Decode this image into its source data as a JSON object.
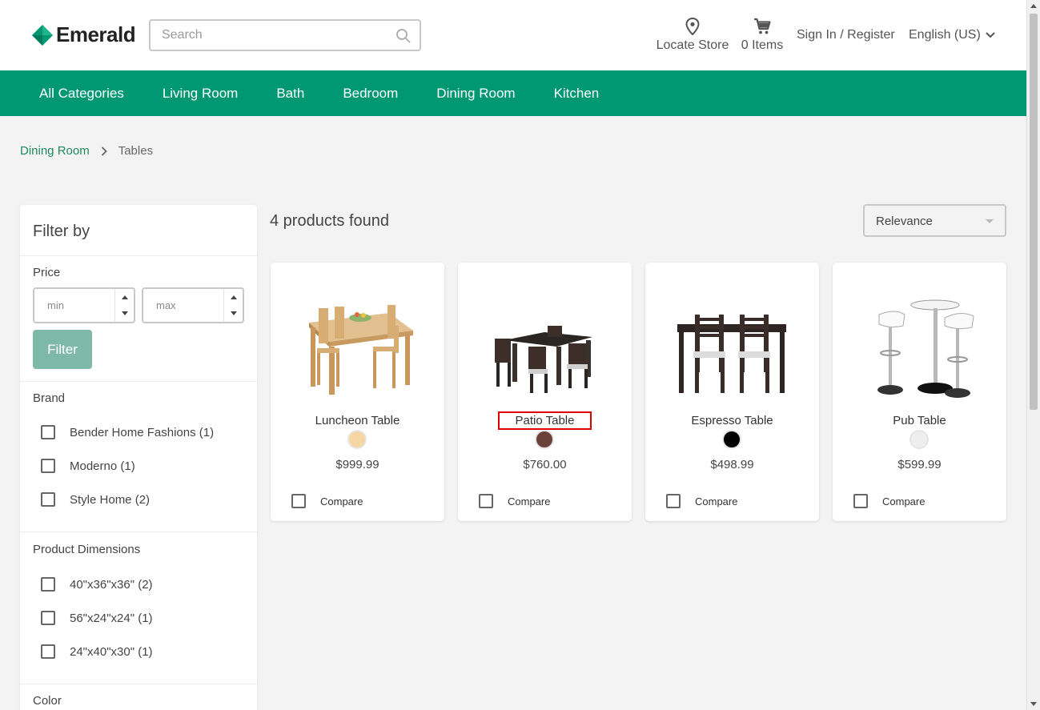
{
  "header": {
    "brand": "Emerald",
    "search_placeholder": "Search",
    "locate_label": "Locate Store",
    "cart_label": "0 Items",
    "signin_label": "Sign In / Register",
    "language_label": "English (US)"
  },
  "nav": {
    "items": [
      "All Categories",
      "Living Room",
      "Bath",
      "Bedroom",
      "Dining Room",
      "Kitchen"
    ]
  },
  "breadcrumb": {
    "parent": "Dining Room",
    "current": "Tables"
  },
  "filters": {
    "title": "Filter by",
    "price": {
      "title": "Price",
      "min_placeholder": "min",
      "max_placeholder": "max",
      "button": "Filter"
    },
    "brand": {
      "title": "Brand",
      "options": [
        "Bender Home Fashions (1)",
        "Moderno (1)",
        "Style Home (2)"
      ]
    },
    "dimensions": {
      "title": "Product Dimensions",
      "options": [
        "40\"x36\"x36\" (2)",
        "56\"x24\"x24\" (1)",
        "24\"x40\"x30\" (1)"
      ]
    },
    "color": {
      "title": "Color"
    }
  },
  "results": {
    "count_label": "4 products found",
    "sort_value": "Relevance",
    "compare_label": "Compare",
    "products": [
      {
        "name": "Luncheon Table",
        "price": "$999.99",
        "swatch": "#f5d7a3",
        "image": "wood-dining-set"
      },
      {
        "name": "Patio Table",
        "price": "$760.00",
        "swatch": "#6b4238",
        "image": "dark-patio-set"
      },
      {
        "name": "Espresso Table",
        "price": "$498.99",
        "swatch": "#000000",
        "image": "espresso-dining-set"
      },
      {
        "name": "Pub Table",
        "price": "$599.99",
        "swatch": "#eeeeee",
        "image": "pub-bar-set"
      }
    ]
  },
  "colors": {
    "brand_green": "#009873",
    "link_green": "#1f8a5e",
    "filter_button": "#7eb8a6",
    "highlight": "#e00000"
  }
}
